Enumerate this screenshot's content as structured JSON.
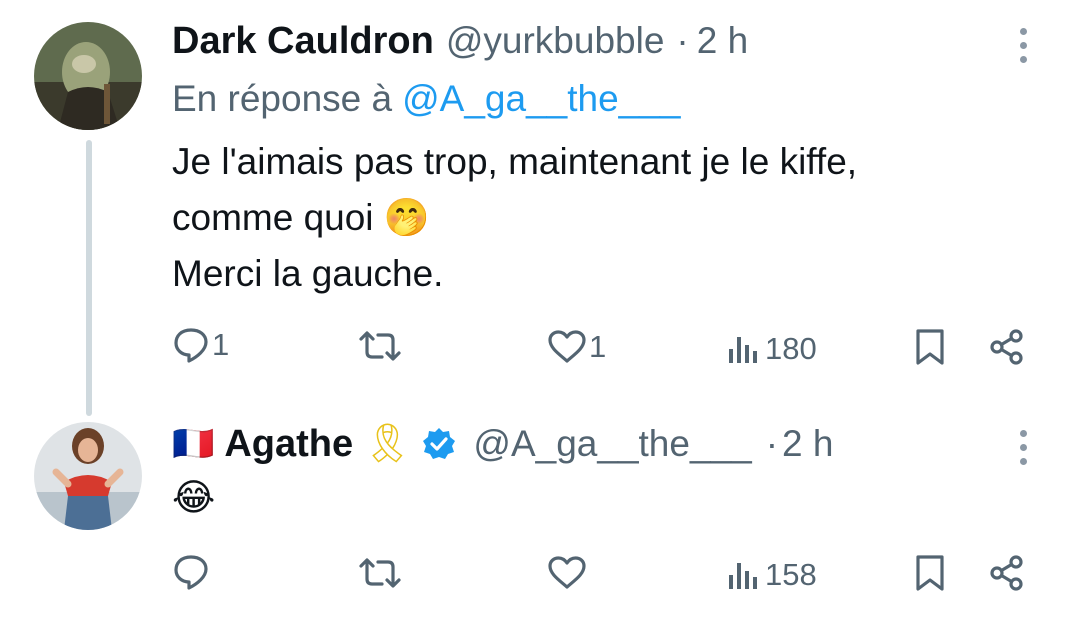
{
  "tweets": [
    {
      "display_name": "Dark Cauldron",
      "handle": "@yurkbubble",
      "separator": "·",
      "time": "2 h",
      "reply_prefix": "En réponse à",
      "reply_to": "@A_ga__the___",
      "lines": [
        "Je l'aimais pas trop, maintenant je le kiffe,",
        "comme quoi",
        "Merci la gauche."
      ],
      "emoji": "🤭",
      "stats": {
        "replies": "1",
        "retweets": "",
        "likes": "1",
        "views": "180"
      }
    },
    {
      "flag": "🇫🇷",
      "display_name": "Agathe",
      "ribbon": "🎗",
      "handle": "@A_ga__the___",
      "separator": "·",
      "time": "2 h",
      "emoji": "😂",
      "stats": {
        "replies": "",
        "retweets": "",
        "likes": "",
        "views": "158"
      }
    }
  ],
  "colors": {
    "link": "#1d9bf0",
    "muted": "#536471",
    "verified": "#1d9bf0",
    "thread_line": "#cfd9de"
  }
}
